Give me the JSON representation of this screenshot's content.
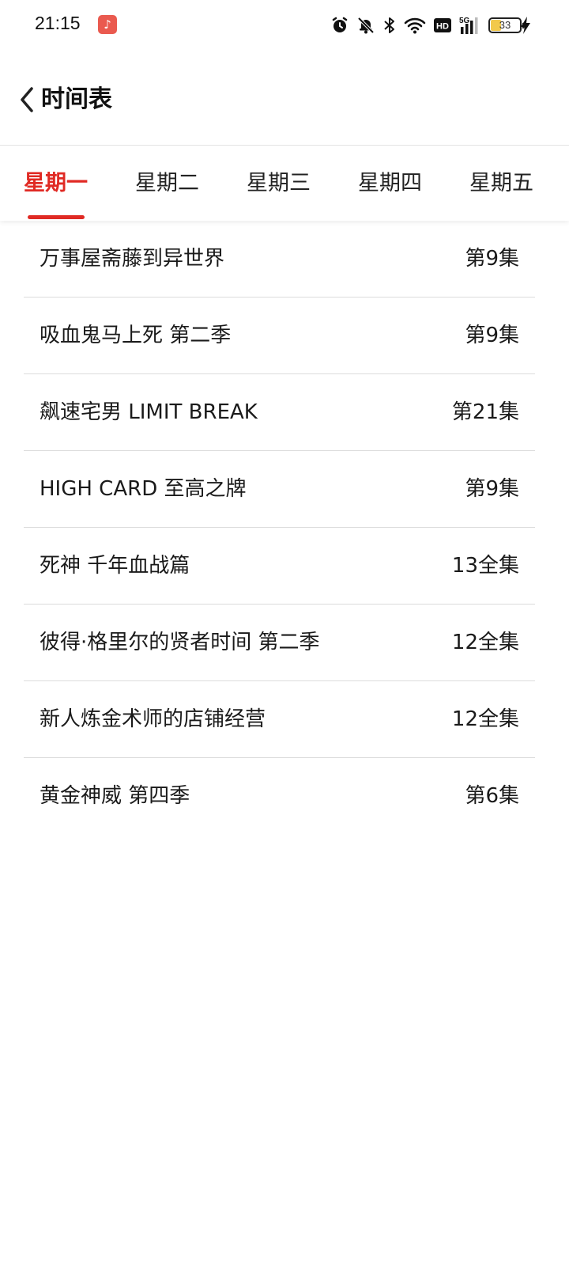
{
  "status_bar": {
    "time": "21:15",
    "app_badge_icon": "music-note-icon",
    "battery_level": "33",
    "battery_fraction": 0.33,
    "icons": [
      "alarm-icon",
      "bell-off-icon",
      "bluetooth-icon",
      "wifi-icon",
      "hd-icon",
      "5g-signal-icon",
      "battery-icon",
      "charging-icon"
    ]
  },
  "header": {
    "title": "时间表"
  },
  "tabs": [
    {
      "label": "星期一",
      "active": true
    },
    {
      "label": "星期二",
      "active": false
    },
    {
      "label": "星期三",
      "active": false
    },
    {
      "label": "星期四",
      "active": false
    },
    {
      "label": "星期五",
      "active": false
    }
  ],
  "accent_color": "#e02a24",
  "schedule": [
    {
      "title": "万事屋斋藤到异世界",
      "episode": "第9集"
    },
    {
      "title": "吸血鬼马上死 第二季",
      "episode": "第9集"
    },
    {
      "title": "飙速宅男 LIMIT BREAK",
      "episode": "第21集"
    },
    {
      "title": "HIGH CARD 至高之牌",
      "episode": "第9集"
    },
    {
      "title": "死神 千年血战篇",
      "episode": "13全集"
    },
    {
      "title": "彼得·格里尔的贤者时间 第二季",
      "episode": "12全集"
    },
    {
      "title": "新人炼金术师的店铺经营",
      "episode": "12全集"
    },
    {
      "title": "黄金神威 第四季",
      "episode": "第6集"
    }
  ]
}
